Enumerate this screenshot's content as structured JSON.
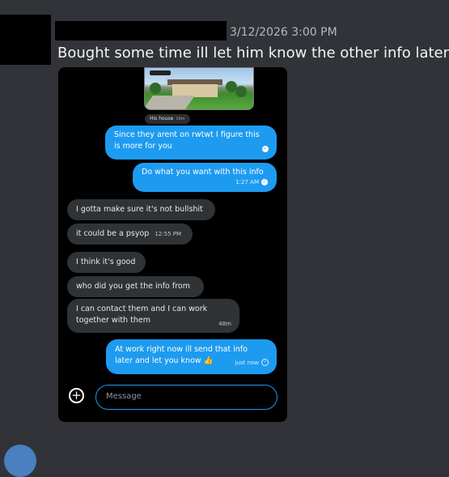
{
  "message": {
    "timestamp": "3/12/2026 3:00 PM",
    "text": "Bought some time ill let him know the other info later"
  },
  "screenshot": {
    "image_caption": "His house",
    "image_caption_time": "16m",
    "messages": [
      {
        "side": "sent",
        "text_lines": [
          "Since they arent on rwtwt I figure this",
          "is more for you"
        ],
        "time": ""
      },
      {
        "side": "sent",
        "text_lines": [
          "Do what you want with this info"
        ],
        "time": "1:27 AM"
      },
      {
        "side": "recv",
        "text_lines": [
          "I gotta make sure it's not bullshit"
        ],
        "time": ""
      },
      {
        "side": "recv",
        "text_lines": [
          "it could be a psyop"
        ],
        "time": "12:55 PM"
      },
      {
        "side": "recv",
        "text_lines": [
          "I think it's good"
        ],
        "time": ""
      },
      {
        "side": "recv",
        "text_lines": [
          "who did you get the info from"
        ],
        "time": ""
      },
      {
        "side": "recv",
        "text_lines": [
          "I can contact them and I can work",
          "together with them"
        ],
        "time": "48m"
      },
      {
        "side": "sent",
        "text_lines": [
          "At work right now ill send that info",
          "later and let you know 👍"
        ],
        "time": "just now"
      }
    ],
    "composer_placeholder": "Message"
  },
  "icons": {
    "add": "plus-circle-icon",
    "read": "check-circle-icon"
  },
  "colors": {
    "accent": "#1d9bf0",
    "received_bubble": "#2f3336",
    "background": "#313338"
  }
}
